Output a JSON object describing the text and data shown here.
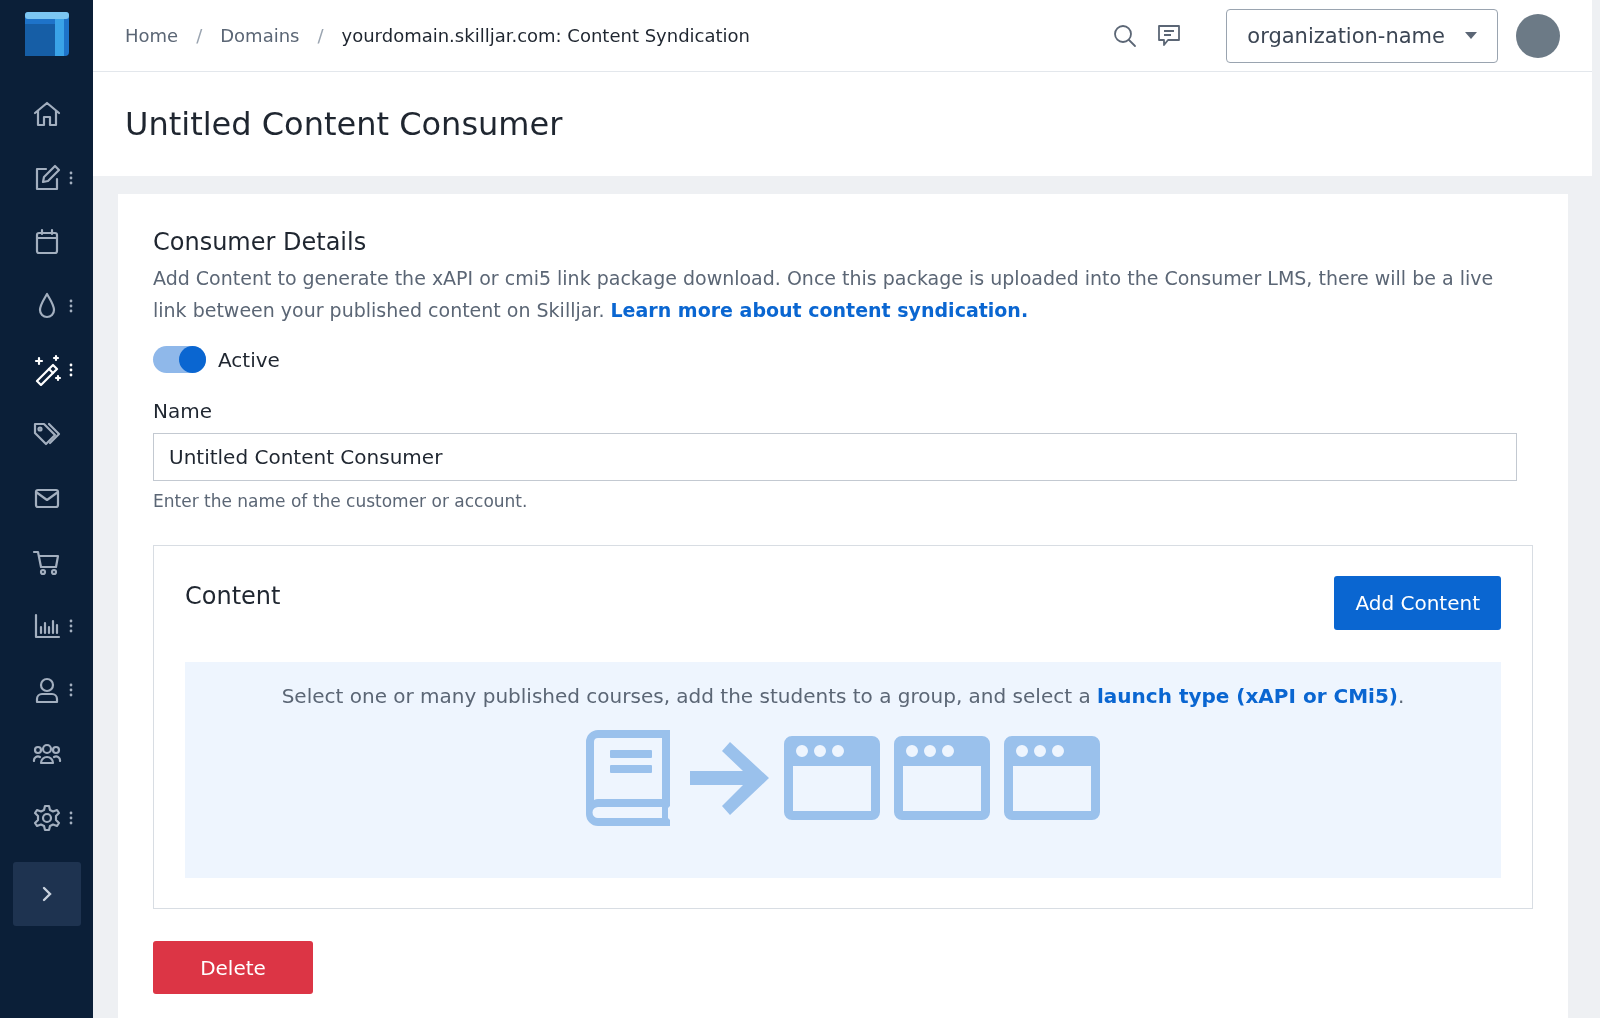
{
  "sidebar": {
    "items": [
      {
        "selected": false,
        "has_menu": false
      },
      {
        "selected": false,
        "has_menu": true
      },
      {
        "selected": false,
        "has_menu": false
      },
      {
        "selected": false,
        "has_menu": true
      },
      {
        "selected": true,
        "has_menu": true
      },
      {
        "selected": false,
        "has_menu": false
      },
      {
        "selected": false,
        "has_menu": false
      },
      {
        "selected": false,
        "has_menu": false
      },
      {
        "selected": false,
        "has_menu": true
      },
      {
        "selected": false,
        "has_menu": true
      },
      {
        "selected": false,
        "has_menu": false
      },
      {
        "selected": false,
        "has_menu": true
      }
    ]
  },
  "breadcrumbs": [
    {
      "label": "Home",
      "separator": "/"
    },
    {
      "label": "Domains",
      "separator": "/"
    },
    {
      "label": "yourdomain.skilljar.com: Content Syndication"
    }
  ],
  "organization_select": {
    "value": "organization-name"
  },
  "page_title": "Untitled Content Consumer",
  "consumer_details": {
    "heading": "Consumer Details",
    "description": "Add Content to generate the xAPI or cmi5 link package download. Once this package is uploaded into the Consumer LMS, there will be a live link between your published content on Skilljar.",
    "link": "Learn more about content syndication.",
    "toggle": {
      "label": "Active",
      "on": true
    },
    "name_field": {
      "label": "Name",
      "value": "Untitled Content Consumer",
      "help": "Enter the name of the customer or account."
    }
  },
  "content": {
    "heading": "Content",
    "add_button": "Add Content",
    "info": {
      "text": "Select one or many published courses, add the students to a group, and select a",
      "link": "launch type (xAPI or CMi5)",
      "suffix": "."
    }
  },
  "delete_button": "Delete"
}
